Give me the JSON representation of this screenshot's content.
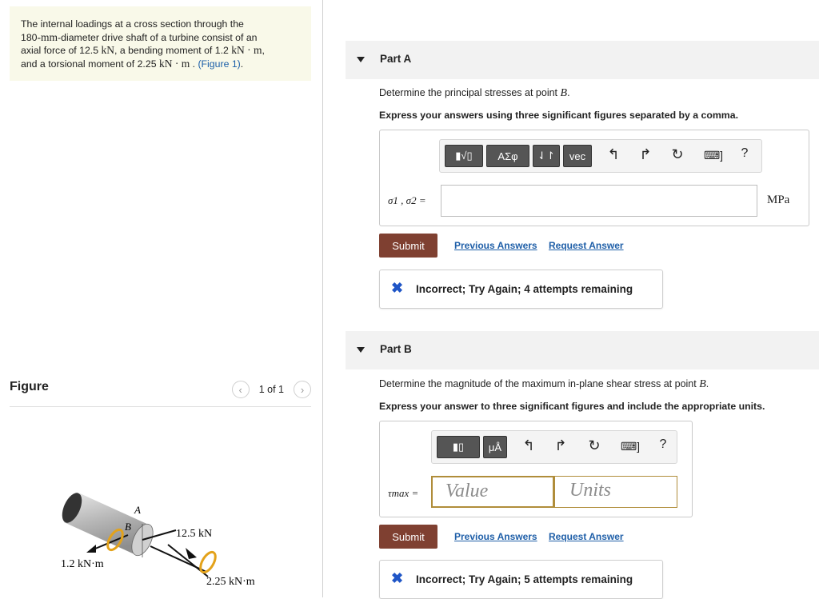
{
  "problem": {
    "line1": "The internal loadings at a cross section through the",
    "line2_num": "180",
    "line2_unit": "-mm",
    "line2_rest": "-diameter drive shaft of a turbine consist of an",
    "line3_pre": "axial force of 12.5 ",
    "line3_unit1": "kN",
    "line3_mid": ", a bending moment of 1.2 ",
    "line3_unit2": "kN · m",
    "line3_end": ",",
    "line4_pre": "and a torsional moment of 2.25 ",
    "line4_unit": "kN · m",
    "line4_mid": " . ",
    "line4_link": "(Figure 1)",
    "line4_end": "."
  },
  "figure": {
    "title": "Figure",
    "pager": "1 of 1",
    "labels": {
      "a": "A",
      "b": "B",
      "axial": "12.5 kN",
      "bending": "1.2 kN·m",
      "torsion": "2.25 kN·m"
    }
  },
  "partA": {
    "label": "Part A",
    "question_pre": "Determine the principal stresses at point ",
    "question_point": "B",
    "question_end": ".",
    "instruction": "Express your answers using three significant figures separated by a comma.",
    "variable": "σ1 , σ2 =",
    "unit": "MPa",
    "toolbar": {
      "templates": "▮√▯",
      "greek": "ΑΣφ",
      "arrows": "⇃↾",
      "vec": "vec",
      "help": "?"
    },
    "submit": "Submit",
    "prev_answers": "Previous Answers",
    "request_answer": "Request Answer",
    "feedback": "Incorrect; Try Again; 4 attempts remaining"
  },
  "partB": {
    "label": "Part B",
    "question_pre": "Determine the magnitude of the maximum in-plane shear stress at point ",
    "question_point": "B",
    "question_end": ".",
    "instruction": "Express your answer to three significant figures and include the appropriate units.",
    "variable": "τmax =",
    "value_placeholder": "Value",
    "units_placeholder": "Units",
    "toolbar": {
      "units": "μÅ",
      "help": "?"
    },
    "submit": "Submit",
    "prev_answers": "Previous Answers",
    "request_answer": "Request Answer",
    "feedback": "Incorrect; Try Again; 5 attempts remaining"
  },
  "colors": {
    "submit": "#7f4031",
    "link": "#1f5fa8",
    "x_mark": "#2056c7",
    "problem_bg": "#f9f9e9"
  }
}
